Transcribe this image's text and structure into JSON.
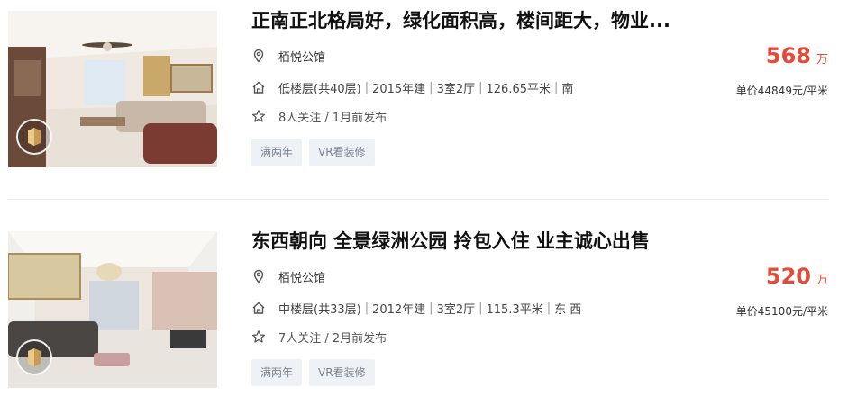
{
  "listings": [
    {
      "title": "正南正北格局好，绿化面积高，楼间距大，物业...",
      "community": "栢悦公馆",
      "floor": "低楼层(共40层)",
      "year": "2015年建",
      "layout": "3室2厅",
      "area": "126.65平米",
      "orientation": "南",
      "follow": "8人关注 / 1月前发布",
      "tags": [
        "满两年",
        "VR看装修"
      ],
      "price": "568",
      "price_unit": "万",
      "unit_price": "单价44849元/平米"
    },
    {
      "title": "东西朝向 全景绿洲公园 拎包入住 业主诚心出售",
      "community": "栢悦公馆",
      "floor": "中楼层(共33层)",
      "year": "2012年建",
      "layout": "3室2厅",
      "area": "115.3平米",
      "orientation": "东 西",
      "follow": "7人关注 / 2月前发布",
      "tags": [
        "满两年",
        "VR看装修"
      ],
      "price": "520",
      "price_unit": "万",
      "unit_price": "单价45100元/平米"
    }
  ],
  "separator": "|"
}
